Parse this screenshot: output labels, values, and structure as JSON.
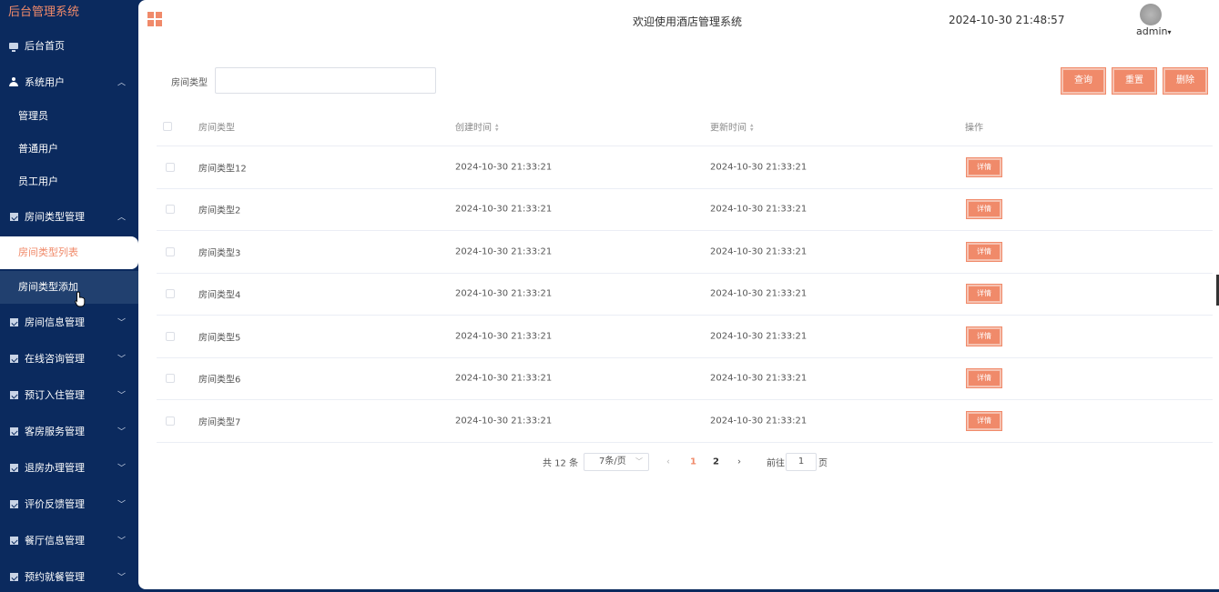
{
  "brand": "后台管理系统",
  "sidebar": {
    "home": "后台首页",
    "system_users": "系统用户",
    "system_users_sub": [
      "管理员",
      "普通用户",
      "员工用户"
    ],
    "room_type_mgmt": "房间类型管理",
    "room_type_sub": [
      "房间类型列表",
      "房间类型添加"
    ],
    "menus": [
      "房间信息管理",
      "在线咨询管理",
      "预订入住管理",
      "客房服务管理",
      "退房办理管理",
      "评价反馈管理",
      "餐厅信息管理",
      "预约就餐管理"
    ]
  },
  "header": {
    "welcome": "欢迎使用酒店管理系统",
    "datetime": "2024-10-30 21:48:57",
    "user": "admin"
  },
  "search": {
    "label": "房间类型",
    "value": "",
    "query_btn": "查询",
    "reset_btn": "重置",
    "delete_btn": "删除"
  },
  "table": {
    "headers": {
      "type": "房间类型",
      "created": "创建时间",
      "updated": "更新时间",
      "ops": "操作"
    },
    "rows": [
      {
        "type": "房间类型12",
        "created": "2024-10-30 21:33:21",
        "updated": "2024-10-30 21:33:21",
        "btn": "详情"
      },
      {
        "type": "房间类型2",
        "created": "2024-10-30 21:33:21",
        "updated": "2024-10-30 21:33:21",
        "btn": "详情"
      },
      {
        "type": "房间类型3",
        "created": "2024-10-30 21:33:21",
        "updated": "2024-10-30 21:33:21",
        "btn": "详情"
      },
      {
        "type": "房间类型4",
        "created": "2024-10-30 21:33:21",
        "updated": "2024-10-30 21:33:21",
        "btn": "详情"
      },
      {
        "type": "房间类型5",
        "created": "2024-10-30 21:33:21",
        "updated": "2024-10-30 21:33:21",
        "btn": "详情"
      },
      {
        "type": "房间类型6",
        "created": "2024-10-30 21:33:21",
        "updated": "2024-10-30 21:33:21",
        "btn": "详情"
      },
      {
        "type": "房间类型7",
        "created": "2024-10-30 21:33:21",
        "updated": "2024-10-30 21:33:21",
        "btn": "详情"
      }
    ]
  },
  "pagination": {
    "total": "共 12 条",
    "page_size": "7条/页",
    "pages": [
      "1",
      "2"
    ],
    "goto": "前往",
    "goto_value": "1",
    "page_unit": "页"
  },
  "colors": {
    "accent": "#f08a6a",
    "sidebar_bg": "#0b2a5e"
  }
}
